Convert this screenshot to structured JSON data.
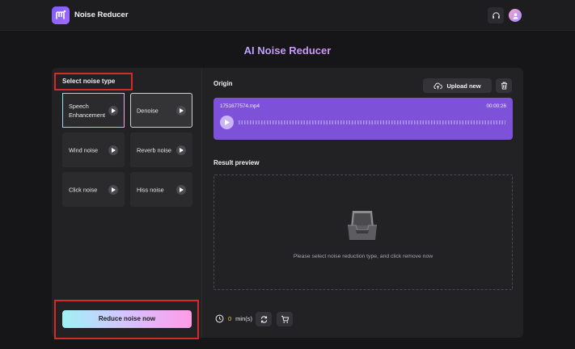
{
  "header": {
    "app_name": "Noise Reducer",
    "logo_icon": "app-logo-icon",
    "plugin_icon": "headset-plugin-icon",
    "avatar_icon": "user-avatar-icon"
  },
  "page": {
    "title": "AI Noise Reducer"
  },
  "noise_panel": {
    "label": "Select noise type",
    "types": [
      {
        "label": "Speech Enhancement",
        "selected": false
      },
      {
        "label": "Denoise",
        "selected": true
      },
      {
        "label": "Wind noise",
        "selected": false
      },
      {
        "label": "Reverb noise",
        "selected": false
      },
      {
        "label": "Click noise",
        "selected": false
      },
      {
        "label": "Hiss noise",
        "selected": false
      }
    ],
    "reduce_label": "Reduce noise now"
  },
  "origin": {
    "label": "Origin",
    "upload_label": "Upload new",
    "file_name": "1751677574.mp4",
    "duration": "00:00:26"
  },
  "result": {
    "label": "Result preview",
    "hint": "Please select noise reduction type, and click remove now"
  },
  "footer": {
    "credits_value": "0",
    "credits_unit": "min(s)"
  },
  "colors": {
    "accent_purple": "#7d52d9",
    "highlight_red": "#d42a2a",
    "credit_yellow": "#f5c84c"
  }
}
